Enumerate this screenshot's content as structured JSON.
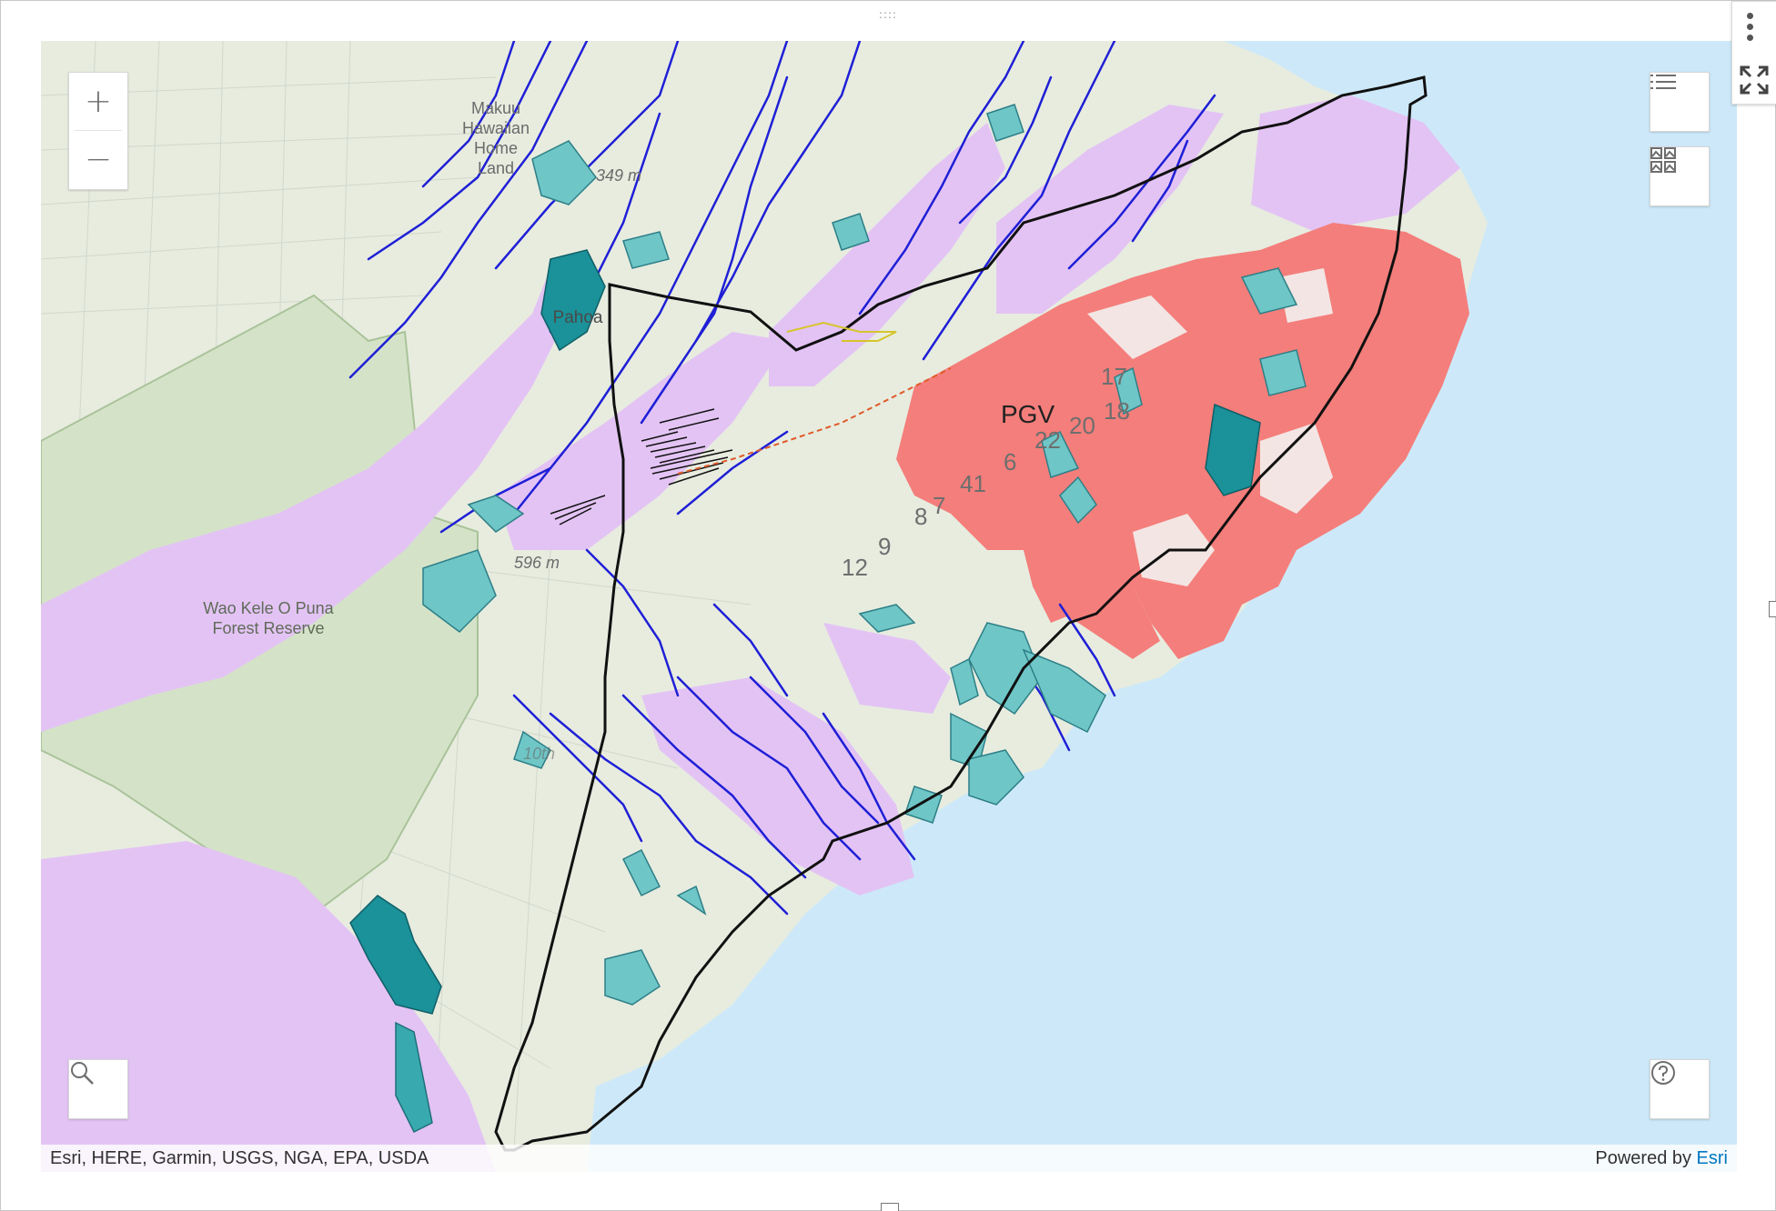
{
  "header": {
    "drag_handle": "::::"
  },
  "map": {
    "labels": {
      "makuu_line1": "Makuu",
      "makuu_line2": "Hawaiian",
      "makuu_line3": "Home",
      "makuu_line4": "Land",
      "pahoa": "Pahoa",
      "elevation1": "349 m",
      "elevation2": "596 m",
      "forest_line1": "Wao Kele O Puna",
      "forest_line2": "Forest Reserve",
      "pgv": "PGV",
      "fissure_17": "17",
      "fissure_18": "18",
      "fissure_20": "20",
      "fissure_22": "22",
      "fissure_6": "6",
      "fissure_41": "41",
      "fissure_8": "8",
      "fissure_7": "7",
      "fissure_9": "9",
      "fissure_12": "12",
      "road_partial": "10th"
    },
    "colors": {
      "ocean": "#cde9f9",
      "land": "#e7ecdf",
      "forest": "#d4e3c8",
      "lava_hazard_purple": "#e3c3f4",
      "lava_flow_red": "#f47e7b",
      "streams": "#1f1fd6",
      "parcels": "#6fc6c6",
      "parcels_dark": "#1b9199",
      "boundary": "#111111",
      "cracks": "#000000"
    }
  },
  "controls": {
    "zoom_in": "+",
    "zoom_out": "−",
    "layer_list_icon": "list-icon",
    "basemap_icon": "basemap-gallery-icon",
    "search_icon": "search-icon",
    "help_icon": "help-icon",
    "more_icon": "more-vertical-icon",
    "expand_icon": "fullscreen-icon"
  },
  "attribution": {
    "sources": "Esri, HERE, Garmin, USGS, NGA, EPA, USDA",
    "powered_prefix": "Powered by ",
    "powered_esri": "Esri"
  }
}
